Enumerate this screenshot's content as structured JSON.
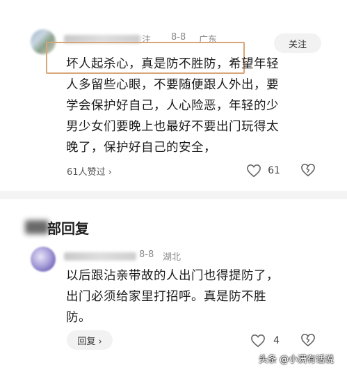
{
  "comment1": {
    "name_suffix": "注",
    "date": "8-8",
    "location": "广东",
    "follow_label": "关注",
    "lines": [
      "坏人起杀心，真是防不胜防，希望年轻",
      "人多留些心眼，不要随便跟人外出，要",
      "学会保护好自己，人心险恶，年轻的少",
      "男少女们要晚上也最好不要出门玩得太",
      "晚了，保护好自己的安全，"
    ],
    "likers_text": "61人赞过 ›",
    "like_count": "61"
  },
  "replies_section": {
    "title_visible": "部回复"
  },
  "comment2": {
    "date": "8-8",
    "location": "湖北",
    "lines": [
      "以后跟沾亲带故的人出门也得提防了，",
      "出门必须给家里打招呼。真是防不胜",
      "防。"
    ],
    "reply_label": "回复 ›",
    "like_count": "4"
  },
  "watermark": "头条 @小满有话说",
  "icons": {
    "like": "heart-outline-icon",
    "dislike": "broken-heart-icon",
    "chevron": "chevron-right-icon"
  }
}
